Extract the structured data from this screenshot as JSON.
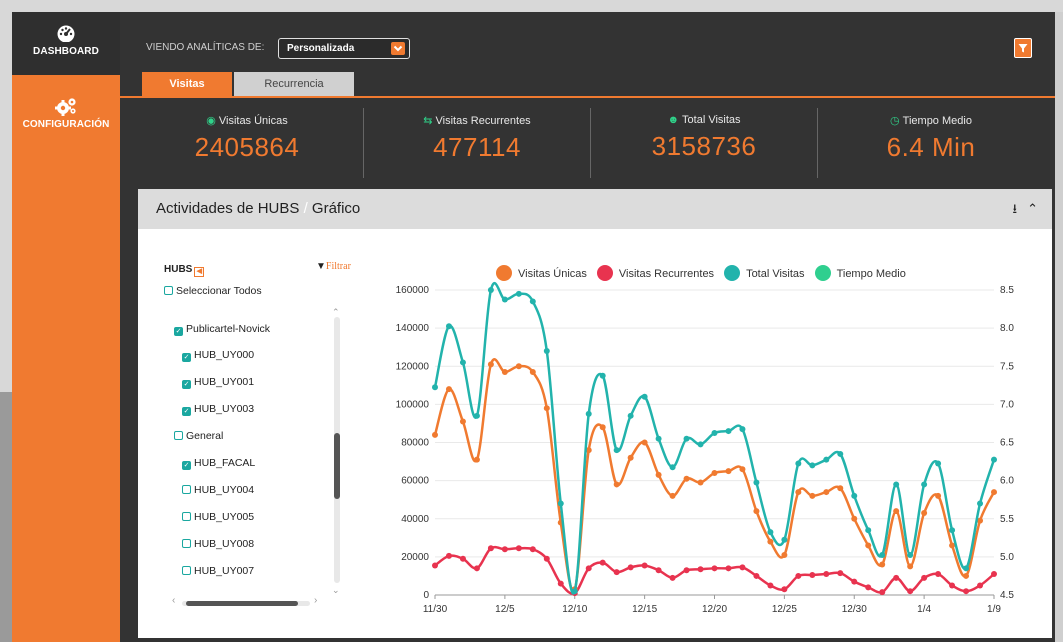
{
  "sidebar": {
    "items": [
      {
        "label": "DASHBOARD",
        "icon": "dashboard-gauge-icon",
        "active": true
      },
      {
        "label": "CONFIGURACIÓN",
        "icon": "gears-icon",
        "active": false
      }
    ]
  },
  "toolbar": {
    "viewing_label": "VIENDO ANALÍTICAS DE:",
    "viewing_value": "Personalizada"
  },
  "tabs": [
    {
      "label": "Visitas",
      "active": true
    },
    {
      "label": "Recurrencia",
      "active": false
    }
  ],
  "stats": [
    {
      "label": "Visitas Únicas",
      "icon": "user-circle-icon",
      "value": "2405864"
    },
    {
      "label": "Visitas Recurrentes",
      "icon": "retweet-icon",
      "value": "477114"
    },
    {
      "label": "Total Visitas",
      "icon": "users-icon",
      "value": "3158736"
    },
    {
      "label": "Tiempo Medio",
      "icon": "clock-icon",
      "value": "6.4 Min"
    }
  ],
  "panel": {
    "title": "Actividades de HUBS",
    "title_sep": " / ",
    "title_sub": "Gráfico"
  },
  "hubs": {
    "heading": "HUBS",
    "filter_label": "Filtrar",
    "items": [
      {
        "label": "Seleccionar Todos",
        "checked": false,
        "level": 0
      },
      {
        "label": "Publicartel-Novick",
        "checked": true,
        "level": 1
      },
      {
        "label": "HUB_UY000",
        "checked": true,
        "level": 2
      },
      {
        "label": "HUB_UY001",
        "checked": true,
        "level": 2
      },
      {
        "label": "HUB_UY003",
        "checked": true,
        "level": 2
      },
      {
        "label": "General",
        "checked": false,
        "level": 1
      },
      {
        "label": "HUB_FACAL",
        "checked": true,
        "level": 2
      },
      {
        "label": "HUB_UY004",
        "checked": false,
        "level": 2
      },
      {
        "label": "HUB_UY005",
        "checked": false,
        "level": 2
      },
      {
        "label": "HUB_UY008",
        "checked": false,
        "level": 2
      },
      {
        "label": "HUB_UY007",
        "checked": false,
        "level": 2
      }
    ]
  },
  "colors": {
    "accent": "#f07a30",
    "teal": "#22b3ac",
    "red": "#e8334f",
    "green": "#2fcf8f"
  },
  "chart_data": {
    "type": "line",
    "x_ticks": [
      "11/30",
      "12/5",
      "12/10",
      "12/15",
      "12/20",
      "12/25",
      "12/30",
      "1/4",
      "1/9"
    ],
    "x_tick_index": [
      0,
      5,
      10,
      15,
      20,
      25,
      30,
      35,
      40
    ],
    "y_left_ticks": [
      "0",
      "20000",
      "40000",
      "60000",
      "80000",
      "100000",
      "120000",
      "140000",
      "160000"
    ],
    "y_left_range": [
      0,
      160000
    ],
    "y_right_ticks": [
      "4.5",
      "5.0",
      "5.5",
      "6.0",
      "6.5",
      "7.0",
      "7.5",
      "8.0",
      "8.5"
    ],
    "y_right_range": [
      4.5,
      8.5
    ],
    "legend_position": "top",
    "grid": true,
    "series": [
      {
        "name": "Visitas Únicas",
        "color": "#f07a30",
        "values": [
          84000,
          108000,
          91000,
          71000,
          121000,
          117000,
          120000,
          117000,
          98000,
          38000,
          3000,
          76000,
          88000,
          58000,
          72000,
          80000,
          63000,
          52000,
          61000,
          59000,
          64000,
          65000,
          66000,
          44000,
          28000,
          21000,
          54000,
          52000,
          54000,
          56000,
          40000,
          26000,
          16000,
          44000,
          15000,
          43000,
          52000,
          26000,
          10000,
          39000,
          54000
        ]
      },
      {
        "name": "Visitas Recurrentes",
        "color": "#e8334f",
        "values": [
          15500,
          20500,
          19000,
          14000,
          24500,
          24000,
          24500,
          24000,
          19000,
          6000,
          1000,
          14000,
          17000,
          12000,
          14500,
          15500,
          13000,
          9000,
          13000,
          13500,
          14000,
          14000,
          14500,
          10000,
          5000,
          3000,
          10000,
          10500,
          11000,
          11500,
          7000,
          4000,
          1500,
          9000,
          2000,
          9000,
          11000,
          5000,
          2000,
          5000,
          11000
        ]
      },
      {
        "name": "Total Visitas",
        "color": "#22b3ac",
        "values": [
          109000,
          141000,
          122000,
          94000,
          160000,
          155000,
          158000,
          154000,
          128000,
          48000,
          2000,
          95000,
          115000,
          76000,
          94000,
          104000,
          82000,
          67000,
          82000,
          79000,
          85000,
          86000,
          87000,
          59000,
          33000,
          29000,
          69000,
          68000,
          71000,
          74000,
          52000,
          34000,
          21000,
          58000,
          21000,
          58000,
          69000,
          34000,
          14000,
          48000,
          71000
        ]
      },
      {
        "name": "Tiempo Medio",
        "color": "#2fcf8f",
        "values": []
      }
    ]
  }
}
